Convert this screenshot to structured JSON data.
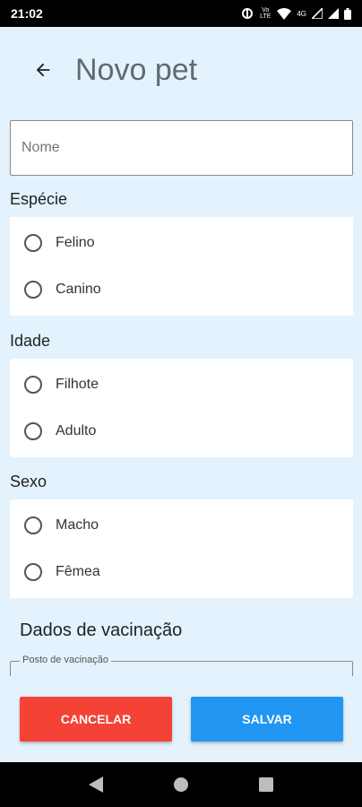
{
  "status_bar": {
    "time": "21:02",
    "volte_label": "Vo LTE",
    "network_label": "4G"
  },
  "app_bar": {
    "title": "Novo pet",
    "back_icon": "arrow-left-icon"
  },
  "form": {
    "name_placeholder": "Nome",
    "name_value": "",
    "species": {
      "label": "Espécie",
      "options": [
        "Felino",
        "Canino"
      ]
    },
    "age": {
      "label": "Idade",
      "options": [
        "Filhote",
        "Adulto"
      ]
    },
    "sex": {
      "label": "Sexo",
      "options": [
        "Macho",
        "Fêmea"
      ]
    },
    "vaccination": {
      "heading": "Dados de vacinação",
      "post_label": "Posto de vacinação"
    }
  },
  "actions": {
    "cancel_label": "CANCELAR",
    "save_label": "SALVAR"
  },
  "colors": {
    "background": "#e3f2fd",
    "cancel": "#f44336",
    "save": "#2196f3",
    "title": "#5f6b73"
  }
}
